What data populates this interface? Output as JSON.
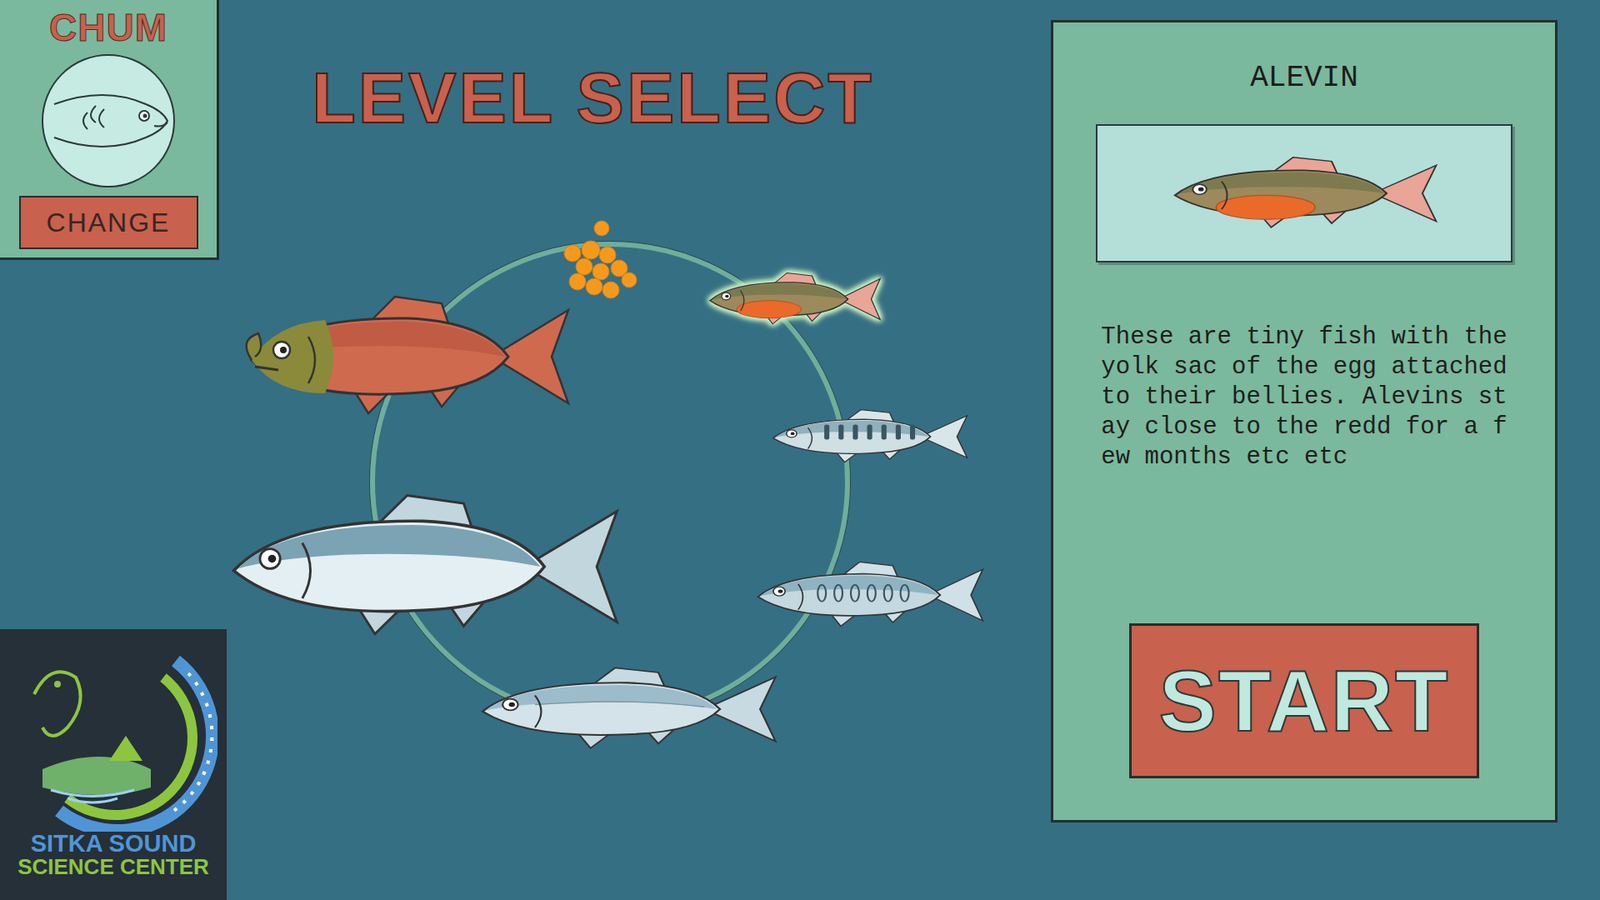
{
  "species": {
    "label": "CHUM",
    "button": "CHANGE"
  },
  "title": "LEVEL SELECT",
  "stages": [
    {
      "kind": "egg",
      "selected": false
    },
    {
      "kind": "alevin",
      "selected": true
    },
    {
      "kind": "fry",
      "selected": false
    },
    {
      "kind": "parr",
      "selected": false
    },
    {
      "kind": "smolt",
      "selected": false
    },
    {
      "kind": "adult",
      "selected": false
    },
    {
      "kind": "spawner",
      "selected": false
    }
  ],
  "detail": {
    "title": "ALEVIN",
    "description": "These are tiny fish with the yolk sac of the egg attached to their bellies. Alevins stay close to the redd for a few months etc etc"
  },
  "start": "START",
  "logo": {
    "line1": "SITKA SOUND",
    "line2": "SCIENCE CENTER"
  }
}
